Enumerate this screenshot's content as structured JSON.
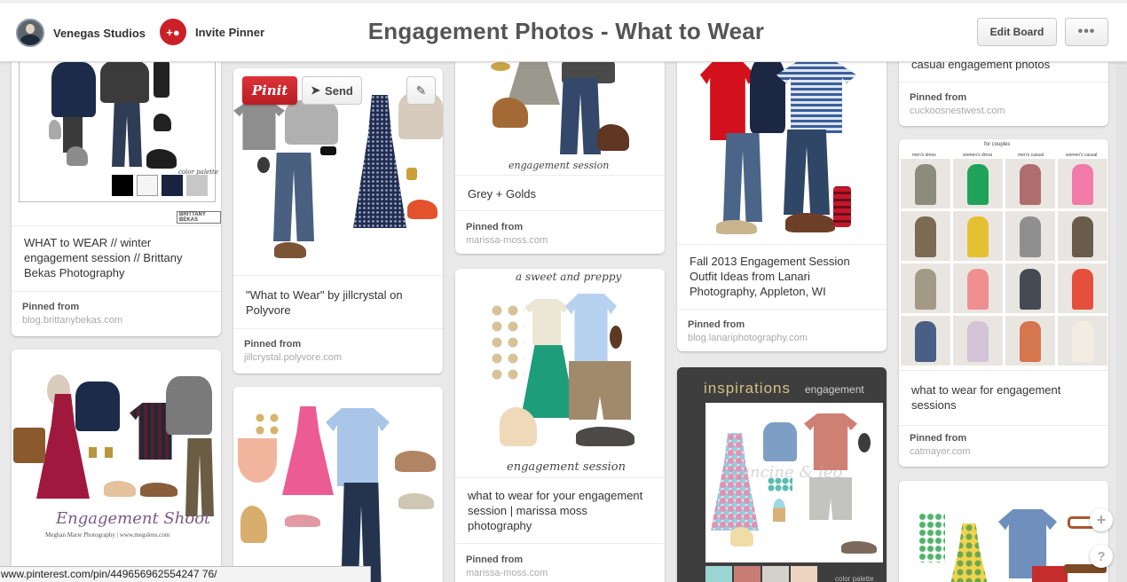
{
  "header": {
    "owner_name": "Venegas Studios",
    "invite_label": "Invite Pinner",
    "board_title": "Engagement Photos - What to Wear",
    "edit_board_label": "Edit Board",
    "more_label": "•••"
  },
  "overlay": {
    "pinit_label": "Pinit",
    "send_label": "Send"
  },
  "pins": [
    {
      "description": "WHAT to WEAR // winter engagement session // Brittany Bekas Photography",
      "pinned_from_label": "Pinned from",
      "source": "blog.brittanybekas.com",
      "image_caption": "BRITTANY BEKAS",
      "palette_label": "color palette"
    },
    {
      "description": "\"What to Wear\" by jillcrystal on Polyvore",
      "pinned_from_label": "Pinned from",
      "source": "jillcrystal.polyvore.com"
    },
    {
      "description": "Grey + Golds",
      "pinned_from_label": "Pinned from",
      "source": "marissa-moss.com",
      "image_caption": "engagement session"
    },
    {
      "description": "Fall 2013 Engagement Session Outfit Ideas from Lanari Photography, Appleton, WI",
      "pinned_from_label": "Pinned from",
      "source": "blog.lanariphotography.com"
    },
    {
      "description": "casual engagement photos",
      "pinned_from_label": "Pinned from",
      "source": "cuckoosnestwest.com"
    },
    {
      "description": "what to wear for engagement sessions",
      "pinned_from_label": "Pinned from",
      "source": "catmayer.com",
      "grid_title": "for couples",
      "grid_headers": [
        "men's dress",
        "women's dress",
        "men's casual",
        "women's casual"
      ]
    },
    {
      "image_title": "Engagement Shoot",
      "image_credit": "Meghan Marie Photography | www.megslens.com"
    },
    {},
    {
      "description": "what to wear for your engagement session | marissa moss photography",
      "pinned_from_label": "Pinned from",
      "source": "marissa-moss.com",
      "image_top": "a sweet and preppy",
      "image_caption": "engagement session"
    },
    {
      "image_title_a": "inspirations",
      "image_title_b": "engagement",
      "watermark": "francine & leo",
      "palette_label": "color palette"
    },
    {}
  ],
  "status_url": "www.pinterest.com/pin/449656962554247 76/",
  "fab_plus": "+",
  "fab_help": "?",
  "colors": {
    "accent": "#cb2027",
    "background": "#e9e9e9"
  }
}
